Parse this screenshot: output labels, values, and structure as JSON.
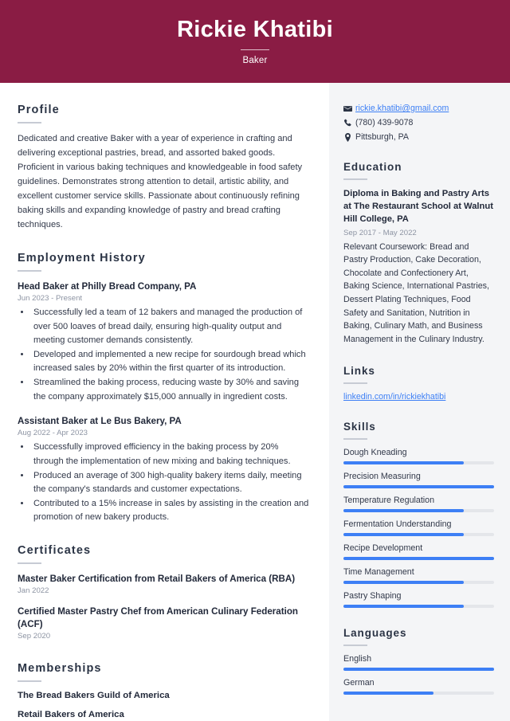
{
  "header": {
    "full_name": "Rickie Khatibi",
    "job_title": "Baker",
    "background_color": "#8a1c44"
  },
  "theme": {
    "accent_color": "#3d7ff5",
    "sidebar_background": "#f4f5f7",
    "rule_color": "#c7cbd4",
    "text_color": "#2b3445",
    "muted_text_color": "#8d94a3"
  },
  "main": {
    "profile": {
      "heading": "Profile",
      "text": "Dedicated and creative Baker with a year of experience in crafting and delivering exceptional pastries, bread, and assorted baked goods. Proficient in various baking techniques and knowledgeable in food safety guidelines. Demonstrates strong attention to detail, artistic ability, and excellent customer service skills. Passionate about continuously refining baking skills and expanding knowledge of pastry and bread crafting techniques."
    },
    "employment": {
      "heading": "Employment History",
      "entries": [
        {
          "title": "Head Baker at Philly Bread Company, PA",
          "date": "Jun 2023 - Present",
          "bullets": [
            "Successfully led a team of 12 bakers and managed the production of over 500 loaves of bread daily, ensuring high-quality output and meeting customer demands consistently.",
            "Developed and implemented a new recipe for sourdough bread which increased sales by 20% within the first quarter of its introduction.",
            "Streamlined the baking process, reducing waste by 30% and saving the company approximately $15,000 annually in ingredient costs."
          ]
        },
        {
          "title": "Assistant Baker at Le Bus Bakery, PA",
          "date": "Aug 2022 - Apr 2023",
          "bullets": [
            "Successfully improved efficiency in the baking process by 20% through the implementation of new mixing and baking techniques.",
            "Produced an average of 300 high-quality bakery items daily, meeting the company's standards and customer expectations.",
            "Contributed to a 15% increase in sales by assisting in the creation and promotion of new bakery products."
          ]
        }
      ]
    },
    "certificates": {
      "heading": "Certificates",
      "entries": [
        {
          "title": "Master Baker Certification from Retail Bakers of America (RBA)",
          "date": "Jan 2022"
        },
        {
          "title": "Certified Master Pastry Chef from American Culinary Federation (ACF)",
          "date": "Sep 2020"
        }
      ]
    },
    "memberships": {
      "heading": "Memberships",
      "entries": [
        "The Bread Bakers Guild of America",
        "Retail Bakers of America"
      ]
    }
  },
  "sidebar": {
    "contact": [
      {
        "icon": "envelope-icon",
        "value": "rickie.khatibi@gmail.com",
        "is_link": true
      },
      {
        "icon": "phone-icon",
        "value": "(780) 439-9078",
        "is_link": false
      },
      {
        "icon": "location-pin-icon",
        "value": "Pittsburgh, PA",
        "is_link": false
      }
    ],
    "education": {
      "heading": "Education",
      "degree": "Diploma in Baking and Pastry Arts at The Restaurant School at Walnut Hill College, PA",
      "date": "Sep 2017 - May 2022",
      "description": "Relevant Coursework: Bread and Pastry Production, Cake Decoration, Chocolate and Confectionery Art, Baking Science, International Pastries, Dessert Plating Techniques, Food Safety and Sanitation, Nutrition in Baking, Culinary Math, and Business Management in the Culinary Industry."
    },
    "links": {
      "heading": "Links",
      "items": [
        {
          "label": "linkedin.com/in/rickiekhatibi"
        }
      ]
    },
    "skills": {
      "heading": "Skills",
      "items": [
        {
          "label": "Dough Kneading",
          "level": 80
        },
        {
          "label": "Precision Measuring",
          "level": 100
        },
        {
          "label": "Temperature Regulation",
          "level": 80
        },
        {
          "label": "Fermentation Understanding",
          "level": 80
        },
        {
          "label": "Recipe Development",
          "level": 100
        },
        {
          "label": "Time Management",
          "level": 80
        },
        {
          "label": "Pastry Shaping",
          "level": 80
        }
      ]
    },
    "languages": {
      "heading": "Languages",
      "items": [
        {
          "label": "English",
          "level": 100
        },
        {
          "label": "German",
          "level": 60
        }
      ]
    }
  }
}
